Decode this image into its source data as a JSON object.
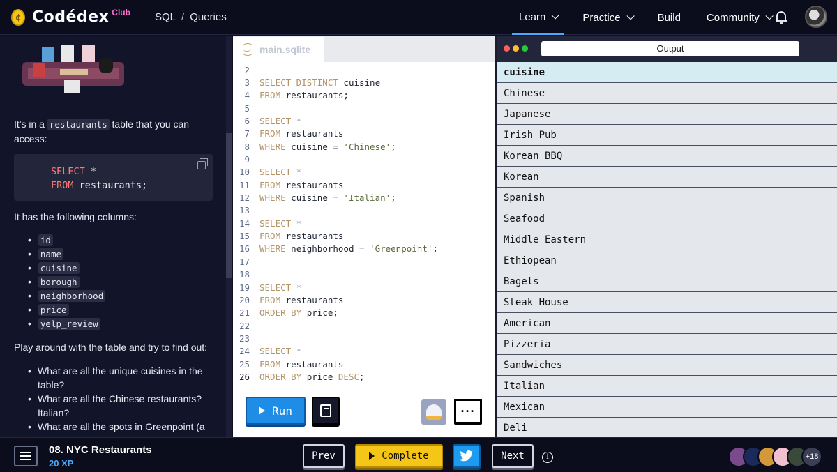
{
  "header": {
    "brand": "Codédex",
    "brand_badge": "Club",
    "breadcrumb": [
      "SQL",
      "Queries"
    ],
    "nav": [
      {
        "label": "Learn",
        "dropdown": true,
        "active": true
      },
      {
        "label": "Practice",
        "dropdown": true,
        "active": false
      },
      {
        "label": "Build",
        "dropdown": false,
        "active": false
      },
      {
        "label": "Community",
        "dropdown": true,
        "active": false
      }
    ],
    "icons": {
      "bell": "bell-icon",
      "avatar": "user-avatar"
    }
  },
  "lesson": {
    "intro_prefix": "It's in a ",
    "intro_code": "restaurants",
    "intro_suffix": " table that you can access:",
    "code_line1_kw": "SELECT",
    "code_line1_rest": " *",
    "code_line2_kw": "FROM",
    "code_line2_rest": " restaurants;",
    "columns_intro": "It has the following columns:",
    "columns": [
      "id",
      "name",
      "cuisine",
      "borough",
      "neighborhood",
      "price",
      "yelp_review"
    ],
    "play_intro": "Play around with the table and try to find out:",
    "questions": [
      "What are all the unique cuisines in the table?",
      "What are all the Chinese restaurants? Italian?",
      "What are all the spots in Greenpoint (a"
    ]
  },
  "editor": {
    "file_tab": "main.sqlite",
    "current_line": "26",
    "lines": [
      {
        "n": "2",
        "parts": []
      },
      {
        "n": "3",
        "parts": [
          [
            "k",
            "SELECT DISTINCT"
          ],
          [
            "t",
            " cuisine"
          ]
        ]
      },
      {
        "n": "4",
        "parts": [
          [
            "k",
            "FROM"
          ],
          [
            "t",
            " restaurants;"
          ]
        ]
      },
      {
        "n": "5",
        "parts": []
      },
      {
        "n": "6",
        "parts": [
          [
            "k",
            "SELECT"
          ],
          [
            "o",
            " *"
          ]
        ]
      },
      {
        "n": "7",
        "parts": [
          [
            "k",
            "FROM"
          ],
          [
            "t",
            " restaurants"
          ]
        ]
      },
      {
        "n": "8",
        "parts": [
          [
            "k",
            "WHERE"
          ],
          [
            "t",
            " cuisine "
          ],
          [
            "o",
            "="
          ],
          [
            "s",
            " 'Chinese'"
          ],
          [
            "t",
            ";"
          ]
        ]
      },
      {
        "n": "9",
        "parts": []
      },
      {
        "n": "10",
        "parts": [
          [
            "k",
            "SELECT"
          ],
          [
            "o",
            " *"
          ]
        ]
      },
      {
        "n": "11",
        "parts": [
          [
            "k",
            "FROM"
          ],
          [
            "t",
            " restaurants"
          ]
        ]
      },
      {
        "n": "12",
        "parts": [
          [
            "k",
            "WHERE"
          ],
          [
            "t",
            " cuisine "
          ],
          [
            "o",
            "="
          ],
          [
            "s",
            " 'Italian'"
          ],
          [
            "t",
            ";"
          ]
        ]
      },
      {
        "n": "13",
        "parts": []
      },
      {
        "n": "14",
        "parts": [
          [
            "k",
            "SELECT"
          ],
          [
            "o",
            " *"
          ]
        ]
      },
      {
        "n": "15",
        "parts": [
          [
            "k",
            "FROM"
          ],
          [
            "t",
            " restaurants"
          ]
        ]
      },
      {
        "n": "16",
        "parts": [
          [
            "k",
            "WHERE"
          ],
          [
            "t",
            " neighborhood "
          ],
          [
            "o",
            "="
          ],
          [
            "s",
            " 'Greenpoint'"
          ],
          [
            "t",
            ";"
          ]
        ]
      },
      {
        "n": "17",
        "parts": []
      },
      {
        "n": "18",
        "parts": []
      },
      {
        "n": "19",
        "parts": [
          [
            "k",
            "SELECT"
          ],
          [
            "o",
            " *"
          ]
        ]
      },
      {
        "n": "20",
        "parts": [
          [
            "k",
            "FROM"
          ],
          [
            "t",
            " restaurants"
          ]
        ]
      },
      {
        "n": "21",
        "parts": [
          [
            "k",
            "ORDER BY"
          ],
          [
            "t",
            " price;"
          ]
        ]
      },
      {
        "n": "22",
        "parts": []
      },
      {
        "n": "23",
        "parts": []
      },
      {
        "n": "24",
        "parts": [
          [
            "k",
            "SELECT"
          ],
          [
            "o",
            " *"
          ]
        ]
      },
      {
        "n": "25",
        "parts": [
          [
            "k",
            "FROM"
          ],
          [
            "t",
            " restaurants"
          ]
        ]
      },
      {
        "n": "26",
        "parts": [
          [
            "k",
            "ORDER BY"
          ],
          [
            "t",
            " price "
          ],
          [
            "k",
            "DESC"
          ],
          [
            "t",
            ";"
          ]
        ]
      }
    ],
    "run_label": "Run",
    "more_label": "···"
  },
  "output": {
    "title": "Output",
    "header": "cuisine",
    "rows": [
      "Chinese",
      "Japanese",
      "Irish Pub",
      "Korean BBQ",
      "Korean",
      "Spanish",
      "Seafood",
      "Middle Eastern",
      "Ethiopean",
      "Bagels",
      "Steak House",
      "American",
      "Pizzeria",
      "Sandwiches",
      "Italian",
      "Mexican",
      "Deli"
    ]
  },
  "footer": {
    "lesson_title": "08. NYC Restaurants",
    "xp": "20 XP",
    "prev": "Prev",
    "complete": "Complete",
    "next": "Next",
    "info": "i",
    "more_count": "+18"
  },
  "colors": {
    "accent": "#4aa8ff",
    "complete": "#f5c518",
    "run": "#1f8ce6",
    "keyword": "#b29468"
  }
}
